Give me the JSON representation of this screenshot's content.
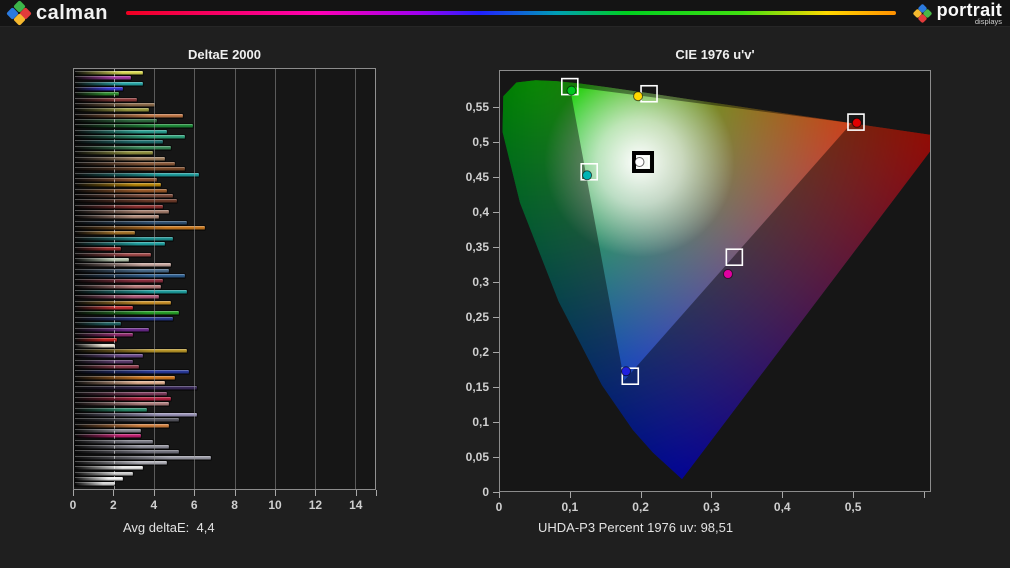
{
  "banner": {
    "brand_left": "calman",
    "brand_right": "portrait",
    "brand_right_sub": "displays",
    "calman_icon_colors": [
      "#3db54a",
      "#e23b3b",
      "#f5b82e",
      "#2b7ade"
    ],
    "portrait_icon_colors": [
      "#2b7ade",
      "#4ab748",
      "#e23b3b",
      "#f5b82e"
    ],
    "spectrum_gradient_stops": [
      "#f00020 0%",
      "#ff00b4 25%",
      "#a000f0 38%",
      "#2020ff 46%",
      "#00a0b4 56%",
      "#00d020 65%",
      "#40e010 80%",
      "#ffd800 91%",
      "#ff9000 100%"
    ]
  },
  "chart_data": [
    {
      "type": "bar",
      "title": "DeltaE 2000",
      "orientation": "horizontal",
      "xlim": [
        0,
        15
      ],
      "x_ticks": [
        {
          "label": "0",
          "value": 0
        },
        {
          "label": "2",
          "value": 2
        },
        {
          "label": "4",
          "value": 4
        },
        {
          "label": "6",
          "value": 6
        },
        {
          "label": "8",
          "value": 8
        },
        {
          "label": "10",
          "value": 10
        },
        {
          "label": "12",
          "value": 12
        },
        {
          "label": "14",
          "value": 14
        },
        {
          "label": "",
          "value": 15
        }
      ],
      "reference_line_value": 2,
      "annotation": "Avg deltaE:  4,4",
      "avg_deltaE": "4,4",
      "bars": [
        {
          "color": "#d8d855",
          "value": 3.4
        },
        {
          "color": "#a43aa4",
          "value": 2.8
        },
        {
          "color": "#2aa8a8",
          "value": 3.4
        },
        {
          "color": "#3838cc",
          "value": 2.4
        },
        {
          "color": "#2e8b2e",
          "value": 2.2
        },
        {
          "color": "#8b3a3a",
          "value": 3.1
        },
        {
          "color": "#8a6a4a",
          "value": 4.0
        },
        {
          "color": "#9a9a40",
          "value": 3.7
        },
        {
          "color": "#c07848",
          "value": 5.4
        },
        {
          "color": "#2f6b3f",
          "value": 4.1
        },
        {
          "color": "#1f8b3a",
          "value": 5.9
        },
        {
          "color": "#2a9d8f",
          "value": 4.6
        },
        {
          "color": "#2fa07a",
          "value": 5.5
        },
        {
          "color": "#1f6f6f",
          "value": 4.4
        },
        {
          "color": "#3a8a5a",
          "value": 4.8
        },
        {
          "color": "#8f8f3f",
          "value": 3.9
        },
        {
          "color": "#a08060",
          "value": 4.5
        },
        {
          "color": "#8a5a3a",
          "value": 5.0
        },
        {
          "color": "#7a4a2a",
          "value": 5.5
        },
        {
          "color": "#1f9d9d",
          "value": 6.2
        },
        {
          "color": "#8a5030",
          "value": 4.1
        },
        {
          "color": "#b8860b",
          "value": 4.3
        },
        {
          "color": "#9a5a2a",
          "value": 4.6
        },
        {
          "color": "#7a4a3a",
          "value": 4.9
        },
        {
          "color": "#6b3a2a",
          "value": 5.1
        },
        {
          "color": "#8b2f2f",
          "value": 4.4
        },
        {
          "color": "#a07a6a",
          "value": 4.7
        },
        {
          "color": "#b08a7a",
          "value": 4.2
        },
        {
          "color": "#2f4f6f",
          "value": 5.6
        },
        {
          "color": "#c87820",
          "value": 6.5
        },
        {
          "color": "#a5742a",
          "value": 3.0
        },
        {
          "color": "#1f8f8f",
          "value": 4.9
        },
        {
          "color": "#20a0a0",
          "value": 4.5
        },
        {
          "color": "#9b2d2d",
          "value": 2.3
        },
        {
          "color": "#a04a4a",
          "value": 3.8
        },
        {
          "color": "#b8c8b0",
          "value": 2.7
        },
        {
          "color": "#c8a8a0",
          "value": 4.8
        },
        {
          "color": "#4a6b8a",
          "value": 4.7
        },
        {
          "color": "#2f5f8f",
          "value": 5.5
        },
        {
          "color": "#8b2f3f",
          "value": 4.4
        },
        {
          "color": "#b87a7a",
          "value": 4.3
        },
        {
          "color": "#1f9d9d",
          "value": 5.6
        },
        {
          "color": "#b05a7a",
          "value": 4.2
        },
        {
          "color": "#c8902a",
          "value": 4.8
        },
        {
          "color": "#c03030",
          "value": 2.9
        },
        {
          "color": "#28a028",
          "value": 5.2
        },
        {
          "color": "#2a3a8a",
          "value": 4.9
        },
        {
          "color": "#1f5f5f",
          "value": 2.3
        },
        {
          "color": "#6a2a8a",
          "value": 3.7
        },
        {
          "color": "#8b2a6b",
          "value": 2.9
        },
        {
          "color": "#c02020",
          "value": 2.1
        },
        {
          "color": "#e8e0d0",
          "value": 2.0
        },
        {
          "color": "#b8962a",
          "value": 5.6
        },
        {
          "color": "#6a4a8a",
          "value": 3.4
        },
        {
          "color": "#5a3a6a",
          "value": 2.9
        },
        {
          "color": "#8b3a4a",
          "value": 3.2
        },
        {
          "color": "#2a3a9a",
          "value": 5.7
        },
        {
          "color": "#d07820",
          "value": 5.0
        },
        {
          "color": "#e0b090",
          "value": 4.5
        },
        {
          "color": "#3a2a5a",
          "value": 6.1
        },
        {
          "color": "#7a3a5a",
          "value": 4.6
        },
        {
          "color": "#b02040",
          "value": 4.8
        },
        {
          "color": "#b08080",
          "value": 4.7
        },
        {
          "color": "#2a8a6a",
          "value": 3.6
        },
        {
          "color": "#9a94b8",
          "value": 6.1
        },
        {
          "color": "#55555f",
          "value": 5.2
        },
        {
          "color": "#d08040",
          "value": 4.7
        },
        {
          "color": "#8a8a92",
          "value": 3.3
        },
        {
          "color": "#c02070",
          "value": 3.3
        },
        {
          "color": "#7a7a85",
          "value": 3.9
        },
        {
          "color": "#8f8f9a",
          "value": 4.7
        },
        {
          "color": "#73737e",
          "value": 5.2
        },
        {
          "color": "#9a9aa5",
          "value": 6.8
        },
        {
          "color": "#b0b0b8",
          "value": 4.6
        },
        {
          "color": "#e6e6e6",
          "value": 3.4
        },
        {
          "color": "#c9c9c9",
          "value": 2.9
        },
        {
          "color": "#f0f0f0",
          "value": 2.4
        },
        {
          "color": "#d4d4d4",
          "value": 2.0
        }
      ]
    },
    {
      "type": "scatter",
      "title": "CIE 1976 u'v'",
      "xlim": [
        0,
        0.61
      ],
      "ylim": [
        0,
        0.603
      ],
      "x_ticks": [
        {
          "label": "0",
          "value": 0
        },
        {
          "label": "0,1",
          "value": 0.1
        },
        {
          "label": "0,2",
          "value": 0.2
        },
        {
          "label": "0,3",
          "value": 0.3
        },
        {
          "label": "0,4",
          "value": 0.4
        },
        {
          "label": "0,5",
          "value": 0.5
        },
        {
          "label": "",
          "value": 0.6
        }
      ],
      "y_ticks": [
        {
          "label": "0",
          "value": 0
        },
        {
          "label": "0,05",
          "value": 0.05
        },
        {
          "label": "0,1",
          "value": 0.1
        },
        {
          "label": "0,15",
          "value": 0.15
        },
        {
          "label": "0,2",
          "value": 0.2
        },
        {
          "label": "0,25",
          "value": 0.25
        },
        {
          "label": "0,3",
          "value": 0.3
        },
        {
          "label": "0,35",
          "value": 0.35
        },
        {
          "label": "0,4",
          "value": 0.4
        },
        {
          "label": "0,45",
          "value": 0.45
        },
        {
          "label": "0,5",
          "value": 0.5
        },
        {
          "label": "0,55",
          "value": 0.55
        }
      ],
      "annotation": "UHDA-P3 Percent 1976 uv: 98,51",
      "gamut_percent_1976uv": "98,51",
      "gamut_triangle_uv": {
        "red": [
          0.4964,
          0.5256
        ],
        "green": [
          0.0986,
          0.5777
        ],
        "blue": [
          0.1754,
          0.1579
        ]
      },
      "points": [
        {
          "name": "green",
          "color": "#00c820",
          "target": [
            0.0986,
            0.5777
          ],
          "measured": [
            0.101,
            0.572
          ]
        },
        {
          "name": "yellow",
          "color": "#ffd800",
          "target": [
            0.2105,
            0.5675
          ],
          "measured": [
            0.195,
            0.564
          ]
        },
        {
          "name": "red",
          "color": "#e00000",
          "target": [
            0.5028,
            0.527
          ],
          "measured": [
            0.504,
            0.526
          ]
        },
        {
          "name": "white",
          "color": "#ffffff",
          "target": [
            0.202,
            0.47
          ],
          "measured": [
            0.197,
            0.47
          ],
          "style": "whitepoint"
        },
        {
          "name": "cyan",
          "color": "#00b4b4",
          "target": [
            0.126,
            0.456
          ],
          "measured": [
            0.123,
            0.451
          ]
        },
        {
          "name": "magenta",
          "color": "#e000a0",
          "target": [
            0.331,
            0.334
          ],
          "measured": [
            0.322,
            0.31
          ]
        },
        {
          "name": "blue",
          "color": "#2020e0",
          "target": [
            0.184,
            0.164
          ],
          "measured": [
            0.178,
            0.171
          ]
        }
      ]
    }
  ]
}
